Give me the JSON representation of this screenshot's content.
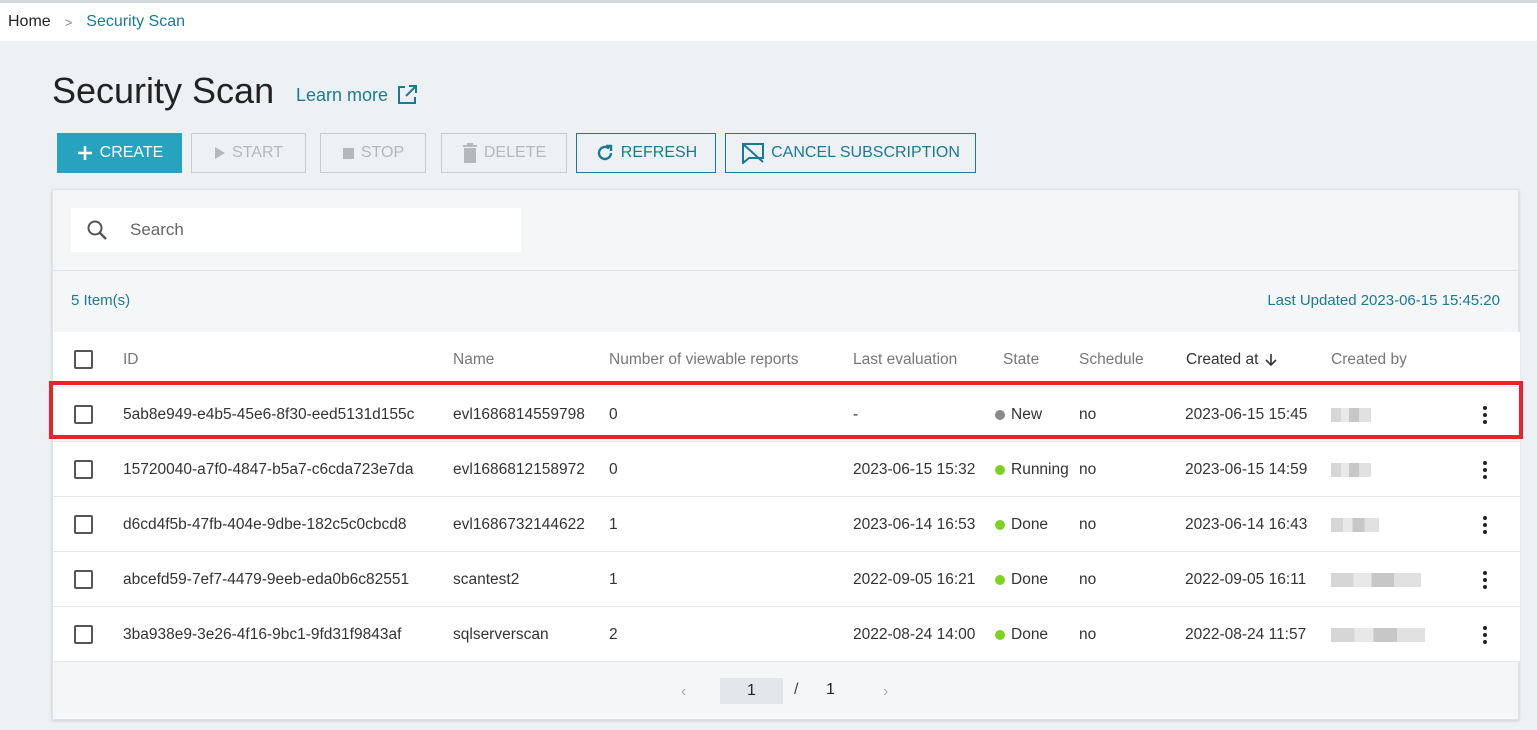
{
  "breadcrumb": {
    "home": "Home",
    "separator": ">",
    "current": "Security Scan"
  },
  "page": {
    "title": "Security Scan",
    "learn_more": "Learn more"
  },
  "toolbar": {
    "create": "CREATE",
    "start": "START",
    "stop": "STOP",
    "delete": "DELETE",
    "refresh": "REFRESH",
    "cancel_subscription": "CANCEL SUBSCRIPTION"
  },
  "search": {
    "placeholder": "Search",
    "value": ""
  },
  "summary": {
    "item_count": "5 Item(s)",
    "last_updated": "Last Updated 2023-06-15 15:45:20"
  },
  "table": {
    "columns": {
      "id": "ID",
      "name": "Name",
      "reports": "Number of viewable reports",
      "last_evaluation": "Last evaluation",
      "state": "State",
      "schedule": "Schedule",
      "created_at": "Created at",
      "created_by": "Created by"
    },
    "rows": [
      {
        "id": "5ab8e949-e4b5-45e6-8f30-eed5131d155c",
        "name": "evl1686814559798",
        "reports": "0",
        "last_evaluation": "-",
        "state": "New",
        "state_color": "#8a8a8a",
        "schedule": "no",
        "created_at": "2023-06-15 15:45"
      },
      {
        "id": "15720040-a7f0-4847-b5a7-c6cda723e7da",
        "name": "evl1686812158972",
        "reports": "0",
        "last_evaluation": "2023-06-15 15:32",
        "state": "Running",
        "state_color": "#7ed321",
        "schedule": "no",
        "created_at": "2023-06-15 14:59"
      },
      {
        "id": "d6cd4f5b-47fb-404e-9dbe-182c5c0cbcd8",
        "name": "evl1686732144622",
        "reports": "1",
        "last_evaluation": "2023-06-14 16:53",
        "state": "Done",
        "state_color": "#7ed321",
        "schedule": "no",
        "created_at": "2023-06-14 16:43"
      },
      {
        "id": "abcefd59-7ef7-4479-9eeb-eda0b6c82551",
        "name": "scantest2",
        "reports": "1",
        "last_evaluation": "2022-09-05 16:21",
        "state": "Done",
        "state_color": "#7ed321",
        "schedule": "no",
        "created_at": "2022-09-05 16:11"
      },
      {
        "id": "3ba938e9-3e26-4f16-9bc1-9fd31f9843af",
        "name": "sqlserverscan",
        "reports": "2",
        "last_evaluation": "2022-08-24 14:00",
        "state": "Done",
        "state_color": "#7ed321",
        "schedule": "no",
        "created_at": "2022-08-24 11:57"
      }
    ]
  },
  "pagination": {
    "current": "1",
    "separator": "/",
    "total": "1"
  },
  "colors": {
    "accent": "#27a3bf",
    "link": "#1a7a95",
    "highlight": "#e8232e"
  }
}
